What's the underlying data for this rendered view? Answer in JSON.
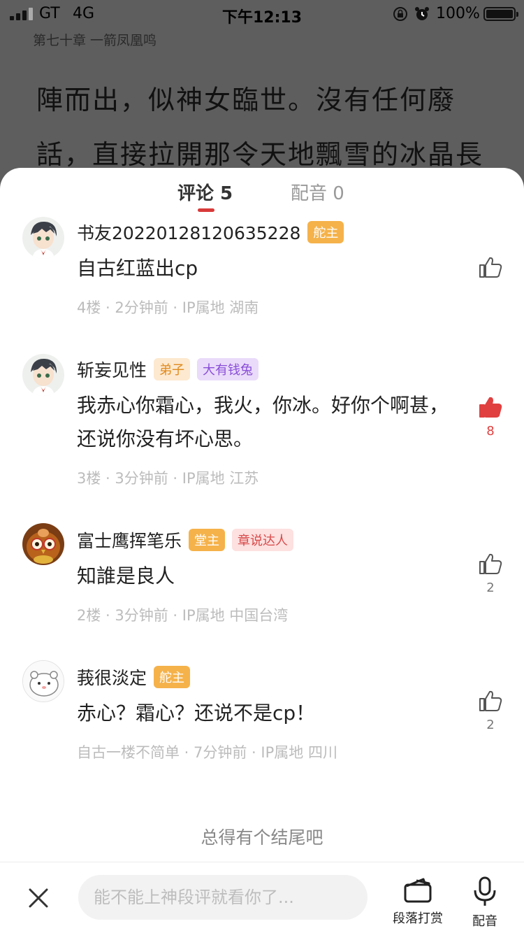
{
  "status_bar": {
    "carrier": "GT",
    "network": "4G",
    "time": "下午12:13",
    "battery": "100%"
  },
  "reader": {
    "chapter_title": "第七十章 一箭凤凰鸣",
    "lines": [
      "陣而出，似神女臨世。沒有任何廢",
      "話，直接拉開那令天地飄雪的冰晶長"
    ]
  },
  "tabs": [
    {
      "label": "评论 5",
      "active": true
    },
    {
      "label": "配音 0",
      "active": false
    }
  ],
  "comments": [
    {
      "author": "书友20220128120635228",
      "badges": [
        {
          "text": "舵主",
          "style": "orange"
        }
      ],
      "text": "自古红蓝出cp",
      "meta": "4楼 · 2分钟前 · IP属地 湖南",
      "likes": "",
      "liked": false,
      "avatar": "avatar-anime-boy"
    },
    {
      "author": "斩妄见性",
      "badges": [
        {
          "text": "弟子",
          "style": "orange-light"
        },
        {
          "text": "大有钱兔",
          "style": "purple"
        }
      ],
      "text": "我赤心你霜心，我火，你冰。好你个啊甚，还说你没有坏心思。",
      "meta": "3楼 · 3分钟前 · IP属地 江苏",
      "likes": "8",
      "liked": true,
      "avatar": "avatar-anime-boy"
    },
    {
      "author": "富士鹰挥笔乐",
      "badges": [
        {
          "text": "堂主",
          "style": "orange"
        },
        {
          "text": "章说达人",
          "style": "pink"
        }
      ],
      "text": "知誰是良人",
      "meta": "2楼 · 3分钟前 · IP属地 中国台湾",
      "likes": "2",
      "liked": false,
      "avatar": "avatar-owl"
    },
    {
      "author": "莪很淡定",
      "badges": [
        {
          "text": "舵主",
          "style": "orange"
        }
      ],
      "text": "赤心？霜心？还说不是cp！",
      "meta": "自古一楼不简单 · 7分钟前 · IP属地 四川",
      "likes": "2",
      "liked": false,
      "avatar": "avatar-hamster"
    }
  ],
  "footer_text": "总得有个结尾吧",
  "bottom_bar": {
    "input_placeholder": "能不能上神段评就看你了...",
    "reward_label": "段落打赏",
    "dub_label": "配音"
  },
  "colors": {
    "accent_red": "#d93a3a",
    "badge_orange": "#f5b24a"
  }
}
